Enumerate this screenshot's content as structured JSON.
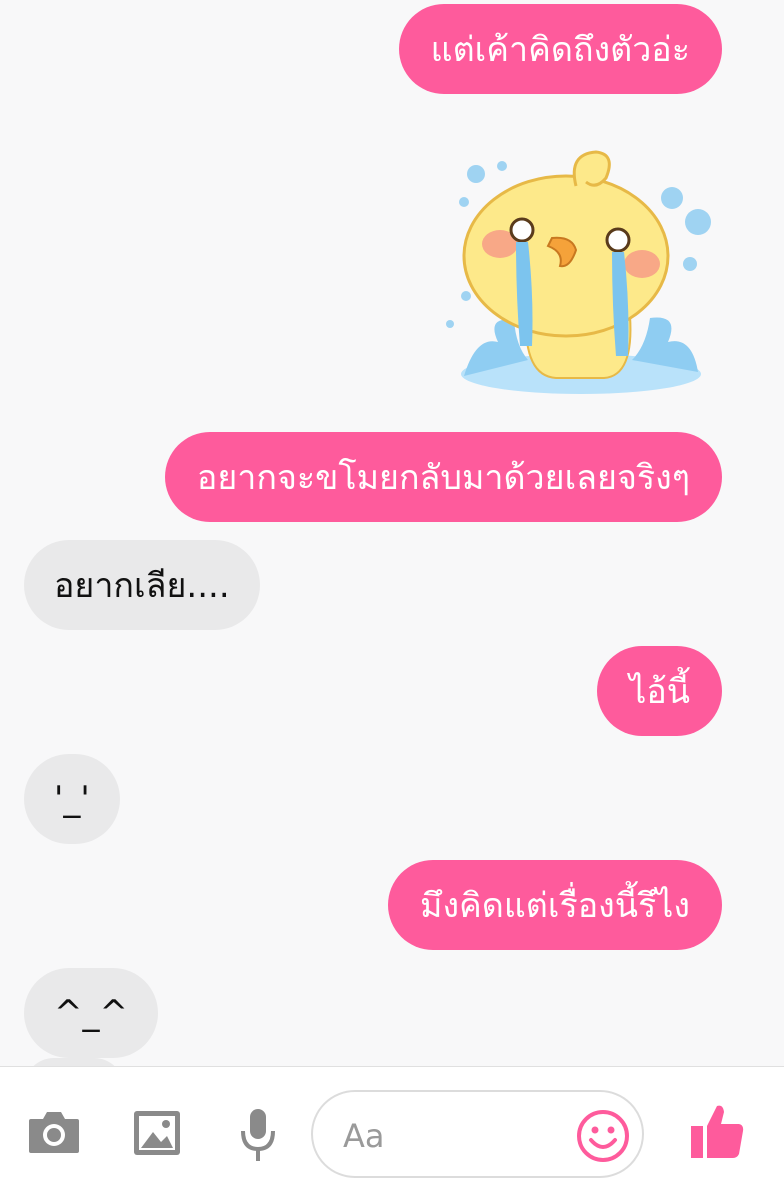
{
  "messages": [
    {
      "direction": "outgoing",
      "text": "แต่เค้าคิดถึงตัวอ่ะ"
    },
    {
      "direction": "outgoing",
      "type": "sticker",
      "sticker": "crying-yellow-chick"
    },
    {
      "direction": "outgoing",
      "text": "อยากจะขโมยกลับมาด้วยเลยจริงๆ"
    },
    {
      "direction": "incoming",
      "text": "อยากเลีย...."
    },
    {
      "direction": "outgoing",
      "text": "ไอ้นี้"
    },
    {
      "direction": "incoming",
      "text": "'_'"
    },
    {
      "direction": "outgoing",
      "text": "มึงคิดแต่เรื่องนี้รึไง"
    },
    {
      "direction": "incoming",
      "text": "^_^"
    }
  ],
  "composer": {
    "placeholder": "Aa",
    "value": ""
  },
  "toolbar": {
    "icons": [
      "camera-icon",
      "image-icon",
      "microphone-icon",
      "emoji-icon",
      "thumbs-up-icon"
    ]
  },
  "colors": {
    "outgoing_bubble": "#fe5b9c",
    "incoming_bubble": "#e9e9ea",
    "accent": "#fe5b9c",
    "toolbar_icon": "#8a8a8a"
  }
}
